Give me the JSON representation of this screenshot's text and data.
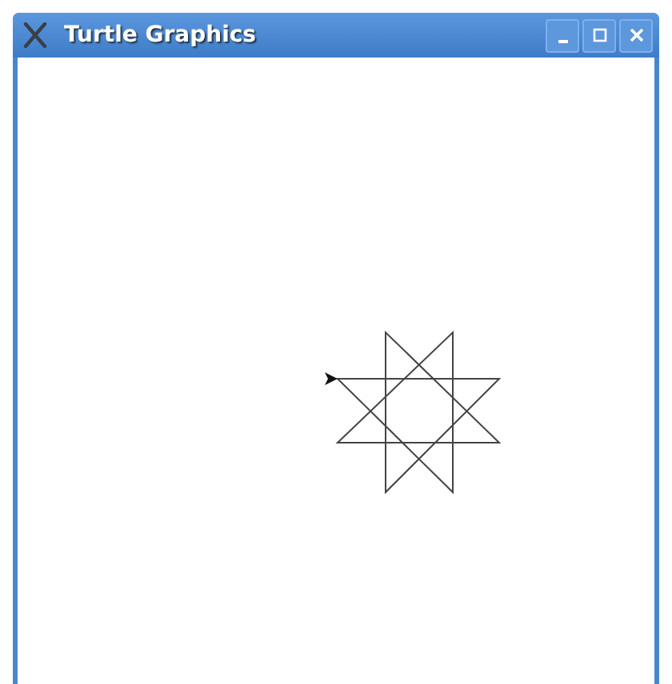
{
  "window": {
    "title": "Turtle Graphics"
  }
}
